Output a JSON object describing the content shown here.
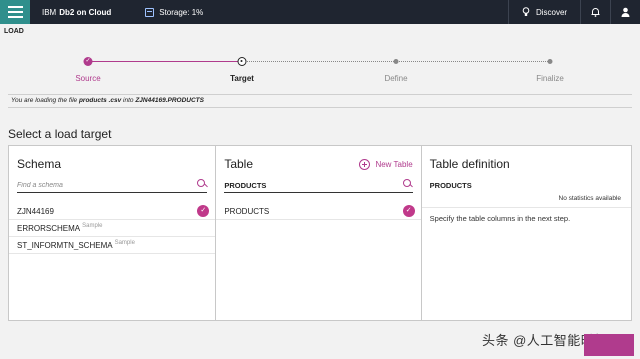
{
  "topbar": {
    "brand_prefix": "IBM",
    "brand_name": "Db2 on Cloud",
    "storage_label": "Storage: 1%",
    "discover_label": "Discover",
    "icons": [
      "menu-icon",
      "database-icon",
      "lightbulb-icon",
      "bell-icon",
      "user-icon"
    ]
  },
  "page": {
    "title": "LOAD",
    "section_heading": "Select a load target"
  },
  "stepper": {
    "steps": [
      {
        "label": "Source",
        "state": "done"
      },
      {
        "label": "Target",
        "state": "current"
      },
      {
        "label": "Define",
        "state": "todo"
      },
      {
        "label": "Finalize",
        "state": "todo"
      }
    ]
  },
  "info": {
    "prefix": "You are loading the file",
    "file": "products .csv",
    "middle": "into",
    "target": "ZJN44169.PRODUCTS"
  },
  "schema_panel": {
    "title": "Schema",
    "search_placeholder": "Find a schema",
    "items": [
      {
        "name": "ZJN44169",
        "tag": "",
        "selected": true
      },
      {
        "name": "ERRORSCHEMA",
        "tag": "Sample",
        "selected": false
      },
      {
        "name": "ST_INFORMTN_SCHEMA",
        "tag": "Sample",
        "selected": false
      }
    ]
  },
  "table_panel": {
    "title": "Table",
    "new_table_label": "New Table",
    "search_value": "PRODUCTS",
    "items": [
      {
        "name": "PRODUCTS",
        "selected": true
      }
    ]
  },
  "definition_panel": {
    "title": "Table definition",
    "table_name": "PRODUCTS",
    "stats_text": "No statistics available",
    "hint": "Specify the table columns in the next step."
  },
  "watermark": "头条 @人工智能时报",
  "colors": {
    "accent": "#b03b8d",
    "topbar": "#1f2530",
    "menu_button": "#2f8f8c"
  }
}
